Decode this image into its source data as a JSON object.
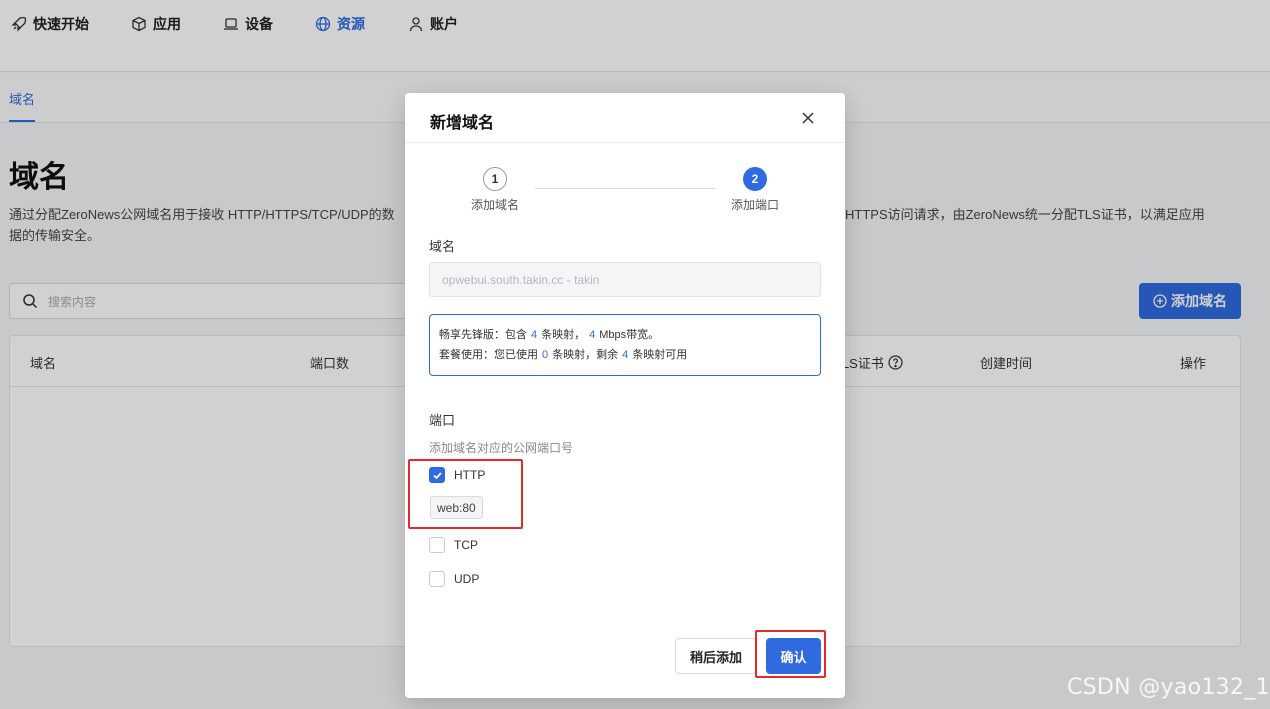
{
  "topnav": {
    "items": [
      {
        "label": "快速开始",
        "icon": "rocket-icon"
      },
      {
        "label": "应用",
        "icon": "cube-icon"
      },
      {
        "label": "设备",
        "icon": "laptop-icon"
      },
      {
        "label": "资源",
        "icon": "globe-icon",
        "active": true
      },
      {
        "label": "账户",
        "icon": "user-icon"
      }
    ]
  },
  "subtabs": {
    "active": "域名"
  },
  "page": {
    "title": "域名",
    "desc_left": "通过分配ZeroNews公网域名用于接收 HTTP/HTTPS/TCP/UDP的数据的传输安全。",
    "desc_right": "HTTPS访问请求，由ZeroNews统一分配TLS证书，以满足应用",
    "desc_line2": "数据的传输安全。",
    "search_placeholder": "搜索内容",
    "add_button": "添加域名"
  },
  "table": {
    "columns": [
      "域名",
      "端口数",
      "TLS证书",
      "创建时间",
      "操作"
    ]
  },
  "modal": {
    "title": "新增域名",
    "steps": [
      {
        "number": "1",
        "label": "添加域名",
        "state": "done"
      },
      {
        "number": "2",
        "label": "添加端口",
        "state": "active"
      }
    ],
    "domain_label": "域名",
    "domain_value": "opwebui.south.takin.cc - takin",
    "info": {
      "line1_prefix": "畅享先锋版：包含",
      "line1_count": "4",
      "line1_mid": "条映射，",
      "line1_bw": "4",
      "line1_suffix": "Mbps带宽。",
      "line2_prefix": "套餐使用：您已使用",
      "line2_used": "0",
      "line2_mid": "条映射，剩余",
      "line2_remaining": "4",
      "line2_suffix": "条映射可用"
    },
    "port_label": "端口",
    "port_hint": "添加域名对应的公网端口号",
    "protocols": [
      {
        "label": "HTTP",
        "checked": true
      },
      {
        "label": "TCP",
        "checked": false
      },
      {
        "label": "UDP",
        "checked": false
      }
    ],
    "http_port_tag": "web:80",
    "later_button": "稍后添加",
    "confirm_button": "确认"
  },
  "watermark": "CSDN @yao132_1",
  "colors": {
    "accent": "#2f6bde",
    "highlight": "#e32b2b"
  }
}
